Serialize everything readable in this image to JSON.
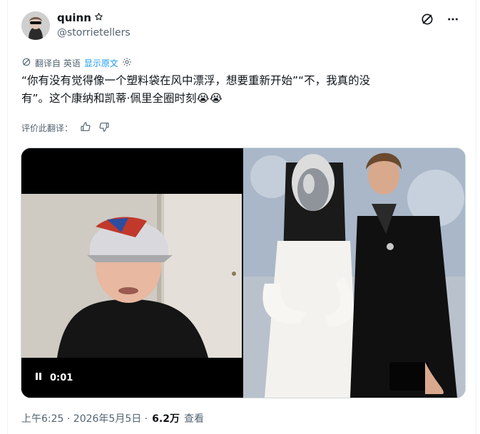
{
  "author": {
    "display_name": "quinn",
    "handle": "@storrietellers",
    "badge_icon": "star-icon"
  },
  "translation": {
    "translated_from": "翻译自 英语",
    "show_original": "显示原文"
  },
  "tweet": {
    "text_line1": "“你有没有觉得像一个塑料袋在风中漂浮，想要重新开始”“不，我真的没",
    "text_line2": "有”。这个康纳和凯蒂·佩里全圈时刻😭😭"
  },
  "rating": {
    "label": "评价此翻译："
  },
  "video": {
    "timestamp": "0:01"
  },
  "meta": {
    "time": "上午6:25 · 2026年5月5日 · ",
    "views_count": "6.2万",
    "views_label": "查看"
  },
  "colors": {
    "link": "#1d9bf0",
    "secondary_text": "#536471",
    "primary_text": "#0f1419"
  }
}
